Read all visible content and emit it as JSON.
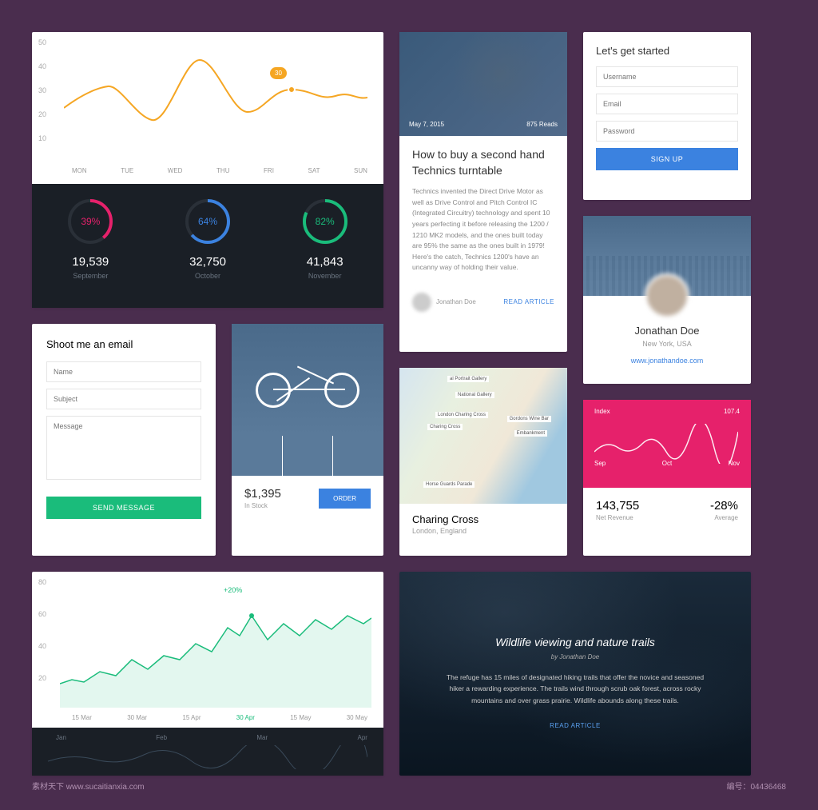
{
  "chart_data": [
    {
      "id": "weekly_line",
      "type": "line",
      "categories": [
        "MON",
        "TUE",
        "WED",
        "THU",
        "FRI",
        "SAT",
        "SUN"
      ],
      "values": [
        28,
        32,
        22,
        40,
        25,
        30,
        32,
        28,
        30
      ],
      "marker": {
        "x": "FRI",
        "value": 30
      },
      "ylim": [
        10,
        50
      ],
      "yticks": [
        10,
        20,
        30,
        40,
        50
      ]
    },
    {
      "id": "gauges",
      "type": "radial",
      "series": [
        {
          "pct": 39,
          "value": "19,539",
          "label": "September",
          "color": "#e6216b"
        },
        {
          "pct": 64,
          "value": "32,750",
          "label": "October",
          "color": "#3b82e0"
        },
        {
          "pct": 82,
          "value": "41,843",
          "label": "November",
          "color": "#1abc7b"
        }
      ]
    },
    {
      "id": "revenue_spark",
      "type": "line",
      "categories": [
        "Sep",
        "Oct",
        "Nov"
      ],
      "index_label": "Index",
      "index_value": "107.4",
      "stat_value": "143,755",
      "stat_label": "Net Revenue",
      "delta": "-28%",
      "delta_label": "Average"
    },
    {
      "id": "green_area",
      "type": "area",
      "yticks": [
        20,
        40,
        60,
        80
      ],
      "xticks": [
        "15 Mar",
        "30 Mar",
        "15 Apr",
        "30 Apr",
        "15 May",
        "30 May"
      ],
      "annotation": "+20%",
      "footer_months": [
        "Jan",
        "Feb",
        "Mar",
        "Apr"
      ]
    }
  ],
  "article": {
    "date": "May 7, 2015",
    "reads": "875 Reads",
    "title": "How to buy a second hand Technics turntable",
    "body": "Technics invented the Direct Drive Motor as well as Drive Control and Pitch Control IC (Integrated Circuitry) technology and spent 10 years perfecting it before releasing the 1200 / 1210 MK2 models, and the ones built today are 95% the same as the ones built in 1979! Here's the catch, Technics 1200's have an uncanny way of holding their value.",
    "author": "Jonathan Doe",
    "cta": "READ ARTICLE"
  },
  "signup": {
    "title": "Let's get started",
    "username": "Username",
    "email": "Email",
    "password": "Password",
    "button": "SIGN UP"
  },
  "profile": {
    "name": "Jonathan Doe",
    "location": "New York, USA",
    "url": "www.jonathandoe.com"
  },
  "email_form": {
    "title": "Shoot me an email",
    "name": "Name",
    "subject": "Subject",
    "message": "Message",
    "button": "SEND MESSAGE"
  },
  "product": {
    "price": "$1,395",
    "stock": "In Stock",
    "button": "ORDER"
  },
  "map": {
    "title": "Charing Cross",
    "subtitle": "London, England",
    "labels": [
      "al Portrait Gallery",
      "National Gallery",
      "London Charing Cross",
      "Charing Cross",
      "Gordons Wine Bar",
      "Embankment",
      "Horse Guards Parade"
    ]
  },
  "nature": {
    "title": "Wildlife viewing and nature trails",
    "by": "by Jonathan Doe",
    "body": "The refuge has 15 miles of designated hiking trails that offer the novice and seasoned hiker a rewarding experience. The trails wind through scrub oak forest, across rocky mountains and over grass prairie. Wildlife abounds along these trails.",
    "cta": "READ ARTICLE"
  },
  "footer": {
    "left": "素材天下 www.sucaitianxia.com",
    "right": "编号：04436468"
  }
}
